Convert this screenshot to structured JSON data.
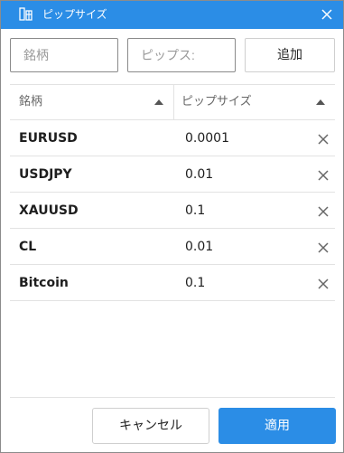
{
  "dialog": {
    "title": "ピップサイズ"
  },
  "form": {
    "symbol_placeholder": "銘柄",
    "pips_placeholder": "ピップス:",
    "add_label": "追加"
  },
  "table": {
    "columns": [
      "銘柄",
      "ピップサイズ"
    ],
    "rows": [
      {
        "symbol": "EURUSD",
        "pip_size": "0.0001"
      },
      {
        "symbol": "USDJPY",
        "pip_size": "0.01"
      },
      {
        "symbol": "XAUUSD",
        "pip_size": "0.1"
      },
      {
        "symbol": "CL",
        "pip_size": "0.01"
      },
      {
        "symbol": "Bitcoin",
        "pip_size": "0.1"
      }
    ]
  },
  "footer": {
    "cancel_label": "キャンセル",
    "apply_label": "適用"
  },
  "colors": {
    "accent": "#2b8de6",
    "border": "#8a8a8a",
    "divider": "#e2e2e2"
  },
  "icons": {
    "title": "pip-table-icon",
    "close": "close-icon",
    "sort": "sort-up-icon",
    "delete": "delete-x-icon"
  }
}
